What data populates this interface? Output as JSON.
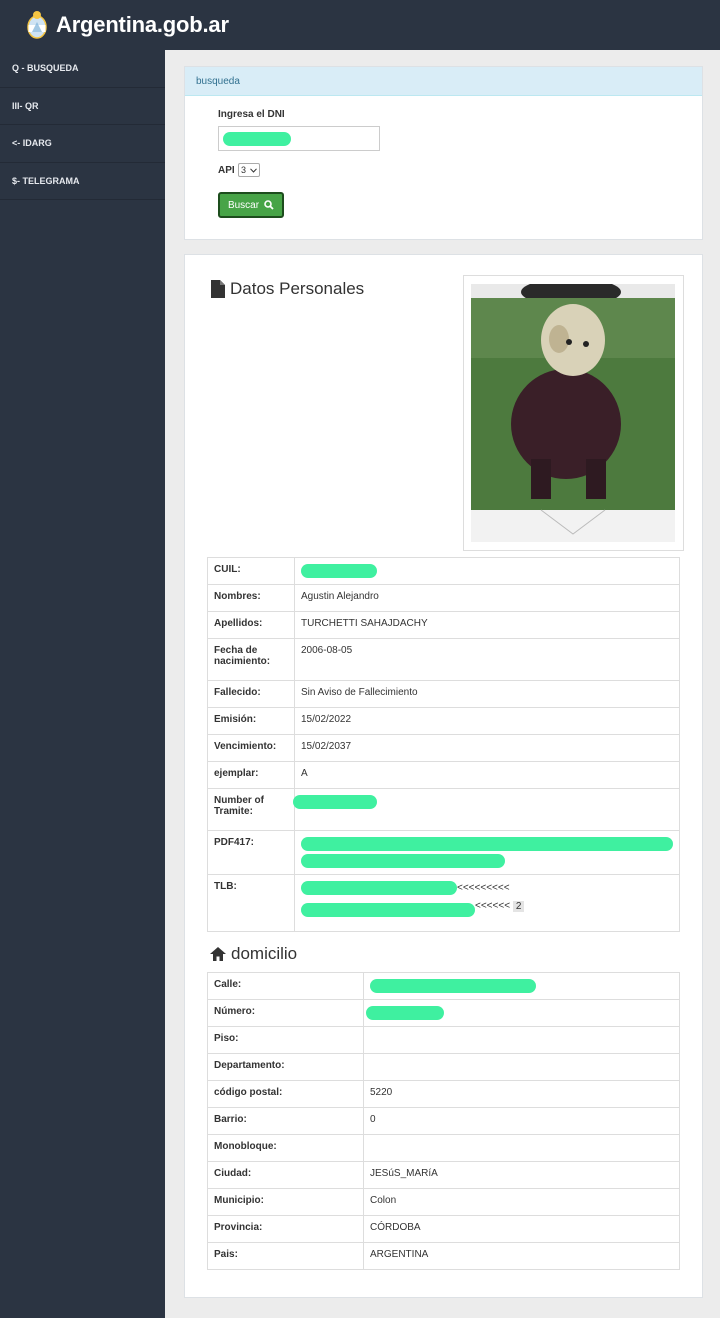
{
  "brand": "Argentina.gob.ar",
  "sidebar": {
    "items": [
      {
        "icon": "search-icon",
        "label": "Q - BUSQUEDA"
      },
      {
        "icon": "barcode-icon",
        "label": "III- QR"
      },
      {
        "icon": "arrow-left-icon",
        "label": "<- IDARG"
      },
      {
        "icon": "dollar-icon",
        "label": "$- TELEGRAMA"
      }
    ]
  },
  "search": {
    "heading": "busqueda",
    "dni_label": "Ingresa el DNI",
    "api_label": "API",
    "api_value": "3",
    "button_label": "Buscar"
  },
  "personal": {
    "title": "Datos Personales",
    "rows": [
      {
        "key": "CUIL:",
        "value": ""
      },
      {
        "key": "Nombres:",
        "value": "Agustin Alejandro"
      },
      {
        "key": "Apellidos:",
        "value": "TURCHETTI SAHAJDACHY"
      },
      {
        "key": "Fecha de nacimiento:",
        "value": "2006-08-05"
      },
      {
        "key": "Fallecido:",
        "value": "Sin Aviso de Fallecimiento"
      },
      {
        "key": "Emisión:",
        "value": "15/02/2022"
      },
      {
        "key": "Vencimiento:",
        "value": "15/02/2037"
      },
      {
        "key": "ejemplar:",
        "value": "A"
      },
      {
        "key": "Number of Tramite:",
        "value": ""
      },
      {
        "key": "PDF417:",
        "value": ""
      },
      {
        "key": "TLB:",
        "value": "<<<<<<<<<",
        "value2": "<<<<<<",
        "badge": "2"
      }
    ]
  },
  "domicilio": {
    "title": "domicilio",
    "rows": [
      {
        "key": "Calle:",
        "value": ""
      },
      {
        "key": "Número:",
        "value": ""
      },
      {
        "key": "Piso:",
        "value": ""
      },
      {
        "key": "Departamento:",
        "value": ""
      },
      {
        "key": "código postal:",
        "value": "5220"
      },
      {
        "key": "Barrio:",
        "value": "0"
      },
      {
        "key": "Monobloque:",
        "value": ""
      },
      {
        "key": "Ciudad:",
        "value": "JESúS_MARíA"
      },
      {
        "key": "Municipio:",
        "value": "Colon"
      },
      {
        "key": "Provincia:",
        "value": "CÓRDOBA"
      },
      {
        "key": "Pais:",
        "value": "ARGENTINA"
      }
    ]
  },
  "colors": {
    "sidebar_bg": "#2b3442",
    "heading_bg": "#d9edf7",
    "button_bg": "#47a447",
    "redaction": "#3ff0a0"
  }
}
